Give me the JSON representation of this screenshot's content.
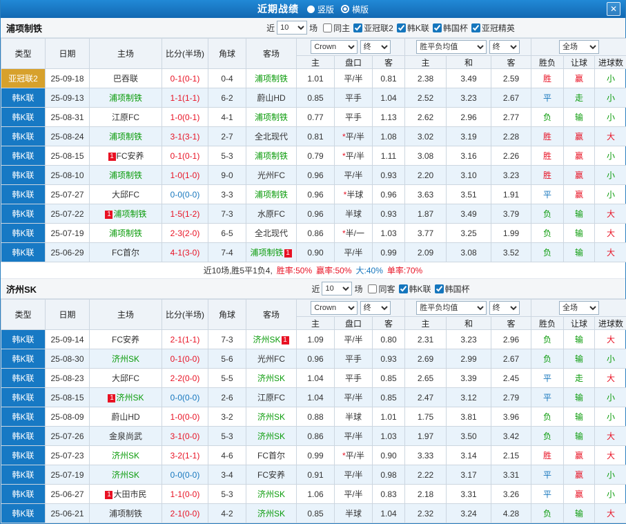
{
  "titlebar": {
    "title": "近期战绩",
    "radio_options": [
      {
        "label": "竖版",
        "selected": false
      },
      {
        "label": "横版",
        "selected": true
      }
    ],
    "close_icon": "✕"
  },
  "colors": {
    "titlebar_blue": "#1576bd",
    "league_blue": "#1779c4",
    "league_gold": "#d7a12c",
    "win_red": "#e81123",
    "lose_green": "#0a9b0a",
    "draw_blue": "#1576bd",
    "row_stripe": "#e9f3fb"
  },
  "sections": [
    {
      "team": "浦项制铁",
      "filters": {
        "near_label": "近",
        "games_count": "10",
        "games_label": "场",
        "checkboxes": [
          {
            "label": "同主",
            "checked": false
          },
          {
            "label": "亚冠联2",
            "checked": true
          },
          {
            "label": "韩K联",
            "checked": true
          },
          {
            "label": "韩国杯",
            "checked": true
          },
          {
            "label": "亚冠精英",
            "checked": true
          }
        ]
      },
      "header": {
        "type": "类型",
        "date": "日期",
        "home": "主场",
        "score": "比分(半场)",
        "corner": "角球",
        "away": "客场",
        "odds_group": {
          "company": "Crown",
          "stage": "终",
          "cols": [
            "主",
            "盘口",
            "客"
          ]
        },
        "europe_group": {
          "company": "胜平负均值",
          "stage": "终",
          "cols": [
            "主",
            "和",
            "客"
          ]
        },
        "result_group": {
          "scope": "全场",
          "cols": [
            "胜负",
            "让球",
            "进球数"
          ]
        }
      },
      "rows": [
        {
          "type": "亚冠联2",
          "type_style": "t-gold",
          "date": "25-09-18",
          "home": {
            "name": "巴吞联",
            "hl": false,
            "card": null
          },
          "score": "0-1(0-1)",
          "score_color": "red",
          "corner": "0-4",
          "away": {
            "name": "浦项制铁",
            "hl": true,
            "card": null
          },
          "ah_home": "1.01",
          "ah_star": false,
          "ah": "平/半",
          "ah_away": "0.81",
          "eu_home": "2.38",
          "eu_draw": "3.49",
          "eu_away": "2.59",
          "res": "胜",
          "res_color": "red",
          "let": "赢",
          "let_color": "red",
          "goals": "小",
          "goals_color": "green"
        },
        {
          "type": "韩K联",
          "type_style": "t-blue",
          "date": "25-09-13",
          "home": {
            "name": "浦项制铁",
            "hl": true,
            "card": null
          },
          "score": "1-1(1-1)",
          "score_color": "red",
          "corner": "6-2",
          "away": {
            "name": "蔚山HD",
            "hl": false,
            "card": null
          },
          "ah_home": "0.85",
          "ah_star": false,
          "ah": "平手",
          "ah_away": "1.04",
          "eu_home": "2.52",
          "eu_draw": "3.23",
          "eu_away": "2.67",
          "res": "平",
          "res_color": "blue",
          "let": "走",
          "let_color": "green",
          "goals": "小",
          "goals_color": "green"
        },
        {
          "type": "韩K联",
          "type_style": "t-blue",
          "date": "25-08-31",
          "home": {
            "name": "江原FC",
            "hl": false,
            "card": null
          },
          "score": "1-0(0-1)",
          "score_color": "red",
          "corner": "4-1",
          "away": {
            "name": "浦项制铁",
            "hl": true,
            "card": null
          },
          "ah_home": "0.77",
          "ah_star": false,
          "ah": "平手",
          "ah_away": "1.13",
          "eu_home": "2.62",
          "eu_draw": "2.96",
          "eu_away": "2.77",
          "res": "负",
          "res_color": "green",
          "let": "输",
          "let_color": "green",
          "goals": "小",
          "goals_color": "green"
        },
        {
          "type": "韩K联",
          "type_style": "t-blue",
          "date": "25-08-24",
          "home": {
            "name": "浦项制铁",
            "hl": true,
            "card": null
          },
          "score": "3-1(3-1)",
          "score_color": "red",
          "corner": "2-7",
          "away": {
            "name": "全北现代",
            "hl": false,
            "card": null
          },
          "ah_home": "0.81",
          "ah_star": true,
          "ah": "平/半",
          "ah_away": "1.08",
          "eu_home": "3.02",
          "eu_draw": "3.19",
          "eu_away": "2.28",
          "res": "胜",
          "res_color": "red",
          "let": "赢",
          "let_color": "red",
          "goals": "大",
          "goals_color": "red"
        },
        {
          "type": "韩K联",
          "type_style": "t-blue",
          "date": "25-08-15",
          "home": {
            "name": "FC安养",
            "hl": false,
            "card": "before"
          },
          "score": "0-1(0-1)",
          "score_color": "red",
          "corner": "5-3",
          "away": {
            "name": "浦项制铁",
            "hl": true,
            "card": null
          },
          "ah_home": "0.79",
          "ah_star": true,
          "ah": "平/半",
          "ah_away": "1.11",
          "eu_home": "3.08",
          "eu_draw": "3.16",
          "eu_away": "2.26",
          "res": "胜",
          "res_color": "red",
          "let": "赢",
          "let_color": "red",
          "goals": "小",
          "goals_color": "green"
        },
        {
          "type": "韩K联",
          "type_style": "t-blue",
          "date": "25-08-10",
          "home": {
            "name": "浦项制铁",
            "hl": true,
            "card": null
          },
          "score": "1-0(1-0)",
          "score_color": "red",
          "corner": "9-0",
          "away": {
            "name": "光州FC",
            "hl": false,
            "card": null
          },
          "ah_home": "0.96",
          "ah_star": false,
          "ah": "平/半",
          "ah_away": "0.93",
          "eu_home": "2.20",
          "eu_draw": "3.10",
          "eu_away": "3.23",
          "res": "胜",
          "res_color": "red",
          "let": "赢",
          "let_color": "red",
          "goals": "小",
          "goals_color": "green"
        },
        {
          "type": "韩K联",
          "type_style": "t-blue",
          "date": "25-07-27",
          "home": {
            "name": "大邱FC",
            "hl": false,
            "card": null
          },
          "score": "0-0(0-0)",
          "score_color": "blue",
          "corner": "3-3",
          "away": {
            "name": "浦项制铁",
            "hl": true,
            "card": null
          },
          "ah_home": "0.96",
          "ah_star": true,
          "ah": "半球",
          "ah_away": "0.96",
          "eu_home": "3.63",
          "eu_draw": "3.51",
          "eu_away": "1.91",
          "res": "平",
          "res_color": "blue",
          "let": "赢",
          "let_color": "red",
          "goals": "小",
          "goals_color": "green"
        },
        {
          "type": "韩K联",
          "type_style": "t-blue",
          "date": "25-07-22",
          "home": {
            "name": "浦项制铁",
            "hl": true,
            "card": "before"
          },
          "score": "1-5(1-2)",
          "score_color": "red",
          "corner": "7-3",
          "away": {
            "name": "水原FC",
            "hl": false,
            "card": null
          },
          "ah_home": "0.96",
          "ah_star": false,
          "ah": "半球",
          "ah_away": "0.93",
          "eu_home": "1.87",
          "eu_draw": "3.49",
          "eu_away": "3.79",
          "res": "负",
          "res_color": "green",
          "let": "输",
          "let_color": "green",
          "goals": "大",
          "goals_color": "red"
        },
        {
          "type": "韩K联",
          "type_style": "t-blue",
          "date": "25-07-19",
          "home": {
            "name": "浦项制铁",
            "hl": true,
            "card": null
          },
          "score": "2-3(2-0)",
          "score_color": "red",
          "corner": "6-5",
          "away": {
            "name": "全北现代",
            "hl": false,
            "card": null
          },
          "ah_home": "0.86",
          "ah_star": true,
          "ah": "半/一",
          "ah_away": "1.03",
          "eu_home": "3.77",
          "eu_draw": "3.25",
          "eu_away": "1.99",
          "res": "负",
          "res_color": "green",
          "let": "输",
          "let_color": "green",
          "goals": "大",
          "goals_color": "red"
        },
        {
          "type": "韩K联",
          "type_style": "t-blue",
          "date": "25-06-29",
          "home": {
            "name": "FC首尔",
            "hl": false,
            "card": null
          },
          "score": "4-1(3-0)",
          "score_color": "red",
          "corner": "7-4",
          "away": {
            "name": "浦项制铁",
            "hl": true,
            "card": "after"
          },
          "ah_home": "0.90",
          "ah_star": false,
          "ah": "平/半",
          "ah_away": "0.99",
          "eu_home": "2.09",
          "eu_draw": "3.08",
          "eu_away": "3.52",
          "res": "负",
          "res_color": "green",
          "let": "输",
          "let_color": "green",
          "goals": "大",
          "goals_color": "red"
        }
      ],
      "summary": [
        {
          "text": "近10场,胜5平1负4,",
          "color": "black"
        },
        {
          "text": "胜率:50%",
          "color": "red"
        },
        {
          "text": "赢率:50%",
          "color": "red"
        },
        {
          "text": "大:40%",
          "color": "blue"
        },
        {
          "text": "单率:70%",
          "color": "red"
        }
      ]
    },
    {
      "team": "济州SK",
      "filters": {
        "near_label": "近",
        "games_count": "10",
        "games_label": "场",
        "checkboxes": [
          {
            "label": "同客",
            "checked": false
          },
          {
            "label": "韩K联",
            "checked": true
          },
          {
            "label": "韩国杯",
            "checked": true
          }
        ]
      },
      "header": {
        "type": "类型",
        "date": "日期",
        "home": "主场",
        "score": "比分(半场)",
        "corner": "角球",
        "away": "客场",
        "odds_group": {
          "company": "Crown",
          "stage": "终",
          "cols": [
            "主",
            "盘口",
            "客"
          ]
        },
        "europe_group": {
          "company": "胜平负均值",
          "stage": "终",
          "cols": [
            "主",
            "和",
            "客"
          ]
        },
        "result_group": {
          "scope": "全场",
          "cols": [
            "胜负",
            "让球",
            "进球数"
          ]
        }
      },
      "rows": [
        {
          "type": "韩K联",
          "type_style": "t-blue",
          "date": "25-09-14",
          "home": {
            "name": "FC安养",
            "hl": false,
            "card": null
          },
          "score": "2-1(1-1)",
          "score_color": "red",
          "corner": "7-3",
          "away": {
            "name": "济州SK",
            "hl": true,
            "card": "after"
          },
          "ah_home": "1.09",
          "ah_star": false,
          "ah": "平/半",
          "ah_away": "0.80",
          "eu_home": "2.31",
          "eu_draw": "3.23",
          "eu_away": "2.96",
          "res": "负",
          "res_color": "green",
          "let": "输",
          "let_color": "green",
          "goals": "大",
          "goals_color": "red"
        },
        {
          "type": "韩K联",
          "type_style": "t-blue",
          "date": "25-08-30",
          "home": {
            "name": "济州SK",
            "hl": true,
            "card": null
          },
          "score": "0-1(0-0)",
          "score_color": "red",
          "corner": "5-6",
          "away": {
            "name": "光州FC",
            "hl": false,
            "card": null
          },
          "ah_home": "0.96",
          "ah_star": false,
          "ah": "平手",
          "ah_away": "0.93",
          "eu_home": "2.69",
          "eu_draw": "2.99",
          "eu_away": "2.67",
          "res": "负",
          "res_color": "green",
          "let": "输",
          "let_color": "green",
          "goals": "小",
          "goals_color": "green"
        },
        {
          "type": "韩K联",
          "type_style": "t-blue",
          "date": "25-08-23",
          "home": {
            "name": "大邱FC",
            "hl": false,
            "card": null
          },
          "score": "2-2(0-0)",
          "score_color": "red",
          "corner": "5-5",
          "away": {
            "name": "济州SK",
            "hl": true,
            "card": null
          },
          "ah_home": "1.04",
          "ah_star": false,
          "ah": "平手",
          "ah_away": "0.85",
          "eu_home": "2.65",
          "eu_draw": "3.39",
          "eu_away": "2.45",
          "res": "平",
          "res_color": "blue",
          "let": "走",
          "let_color": "green",
          "goals": "大",
          "goals_color": "red"
        },
        {
          "type": "韩K联",
          "type_style": "t-blue",
          "date": "25-08-15",
          "home": {
            "name": "济州SK",
            "hl": true,
            "card": "before"
          },
          "score": "0-0(0-0)",
          "score_color": "blue",
          "corner": "2-6",
          "away": {
            "name": "江原FC",
            "hl": false,
            "card": null
          },
          "ah_home": "1.04",
          "ah_star": false,
          "ah": "平/半",
          "ah_away": "0.85",
          "eu_home": "2.47",
          "eu_draw": "3.12",
          "eu_away": "2.79",
          "res": "平",
          "res_color": "blue",
          "let": "输",
          "let_color": "green",
          "goals": "小",
          "goals_color": "green"
        },
        {
          "type": "韩K联",
          "type_style": "t-blue",
          "date": "25-08-09",
          "home": {
            "name": "蔚山HD",
            "hl": false,
            "card": null
          },
          "score": "1-0(0-0)",
          "score_color": "red",
          "corner": "3-2",
          "away": {
            "name": "济州SK",
            "hl": true,
            "card": null
          },
          "ah_home": "0.88",
          "ah_star": false,
          "ah": "半球",
          "ah_away": "1.01",
          "eu_home": "1.75",
          "eu_draw": "3.81",
          "eu_away": "3.96",
          "res": "负",
          "res_color": "green",
          "let": "输",
          "let_color": "green",
          "goals": "小",
          "goals_color": "green"
        },
        {
          "type": "韩K联",
          "type_style": "t-blue",
          "date": "25-07-26",
          "home": {
            "name": "金泉尚武",
            "hl": false,
            "card": null
          },
          "score": "3-1(0-0)",
          "score_color": "red",
          "corner": "5-3",
          "away": {
            "name": "济州SK",
            "hl": true,
            "card": null
          },
          "ah_home": "0.86",
          "ah_star": false,
          "ah": "平/半",
          "ah_away": "1.03",
          "eu_home": "1.97",
          "eu_draw": "3.50",
          "eu_away": "3.42",
          "res": "负",
          "res_color": "green",
          "let": "输",
          "let_color": "green",
          "goals": "大",
          "goals_color": "red"
        },
        {
          "type": "韩K联",
          "type_style": "t-blue",
          "date": "25-07-23",
          "home": {
            "name": "济州SK",
            "hl": true,
            "card": null
          },
          "score": "3-2(1-1)",
          "score_color": "red",
          "corner": "4-6",
          "away": {
            "name": "FC首尔",
            "hl": false,
            "card": null
          },
          "ah_home": "0.99",
          "ah_star": true,
          "ah": "平/半",
          "ah_away": "0.90",
          "eu_home": "3.33",
          "eu_draw": "3.14",
          "eu_away": "2.15",
          "res": "胜",
          "res_color": "red",
          "let": "赢",
          "let_color": "red",
          "goals": "大",
          "goals_color": "red"
        },
        {
          "type": "韩K联",
          "type_style": "t-blue",
          "date": "25-07-19",
          "home": {
            "name": "济州SK",
            "hl": true,
            "card": null
          },
          "score": "0-0(0-0)",
          "score_color": "blue",
          "corner": "3-4",
          "away": {
            "name": "FC安养",
            "hl": false,
            "card": null
          },
          "ah_home": "0.91",
          "ah_star": false,
          "ah": "平/半",
          "ah_away": "0.98",
          "eu_home": "2.22",
          "eu_draw": "3.17",
          "eu_away": "3.31",
          "res": "平",
          "res_color": "blue",
          "let": "赢",
          "let_color": "red",
          "goals": "小",
          "goals_color": "green"
        },
        {
          "type": "韩K联",
          "type_style": "t-blue",
          "date": "25-06-27",
          "home": {
            "name": "大田市民",
            "hl": false,
            "card": "before"
          },
          "score": "1-1(0-0)",
          "score_color": "red",
          "corner": "5-3",
          "away": {
            "name": "济州SK",
            "hl": true,
            "card": null
          },
          "ah_home": "1.06",
          "ah_star": false,
          "ah": "平/半",
          "ah_away": "0.83",
          "eu_home": "2.18",
          "eu_draw": "3.31",
          "eu_away": "3.26",
          "res": "平",
          "res_color": "blue",
          "let": "赢",
          "let_color": "red",
          "goals": "小",
          "goals_color": "green"
        },
        {
          "type": "韩K联",
          "type_style": "t-blue",
          "date": "25-06-21",
          "home": {
            "name": "浦项制铁",
            "hl": false,
            "card": null
          },
          "score": "2-1(0-0)",
          "score_color": "red",
          "corner": "4-2",
          "away": {
            "name": "济州SK",
            "hl": true,
            "card": null
          },
          "ah_home": "0.85",
          "ah_star": false,
          "ah": "半球",
          "ah_away": "1.04",
          "eu_home": "2.32",
          "eu_draw": "3.24",
          "eu_away": "4.28",
          "res": "负",
          "res_color": "green",
          "let": "输",
          "let_color": "green",
          "goals": "大",
          "goals_color": "red"
        }
      ]
    }
  ]
}
